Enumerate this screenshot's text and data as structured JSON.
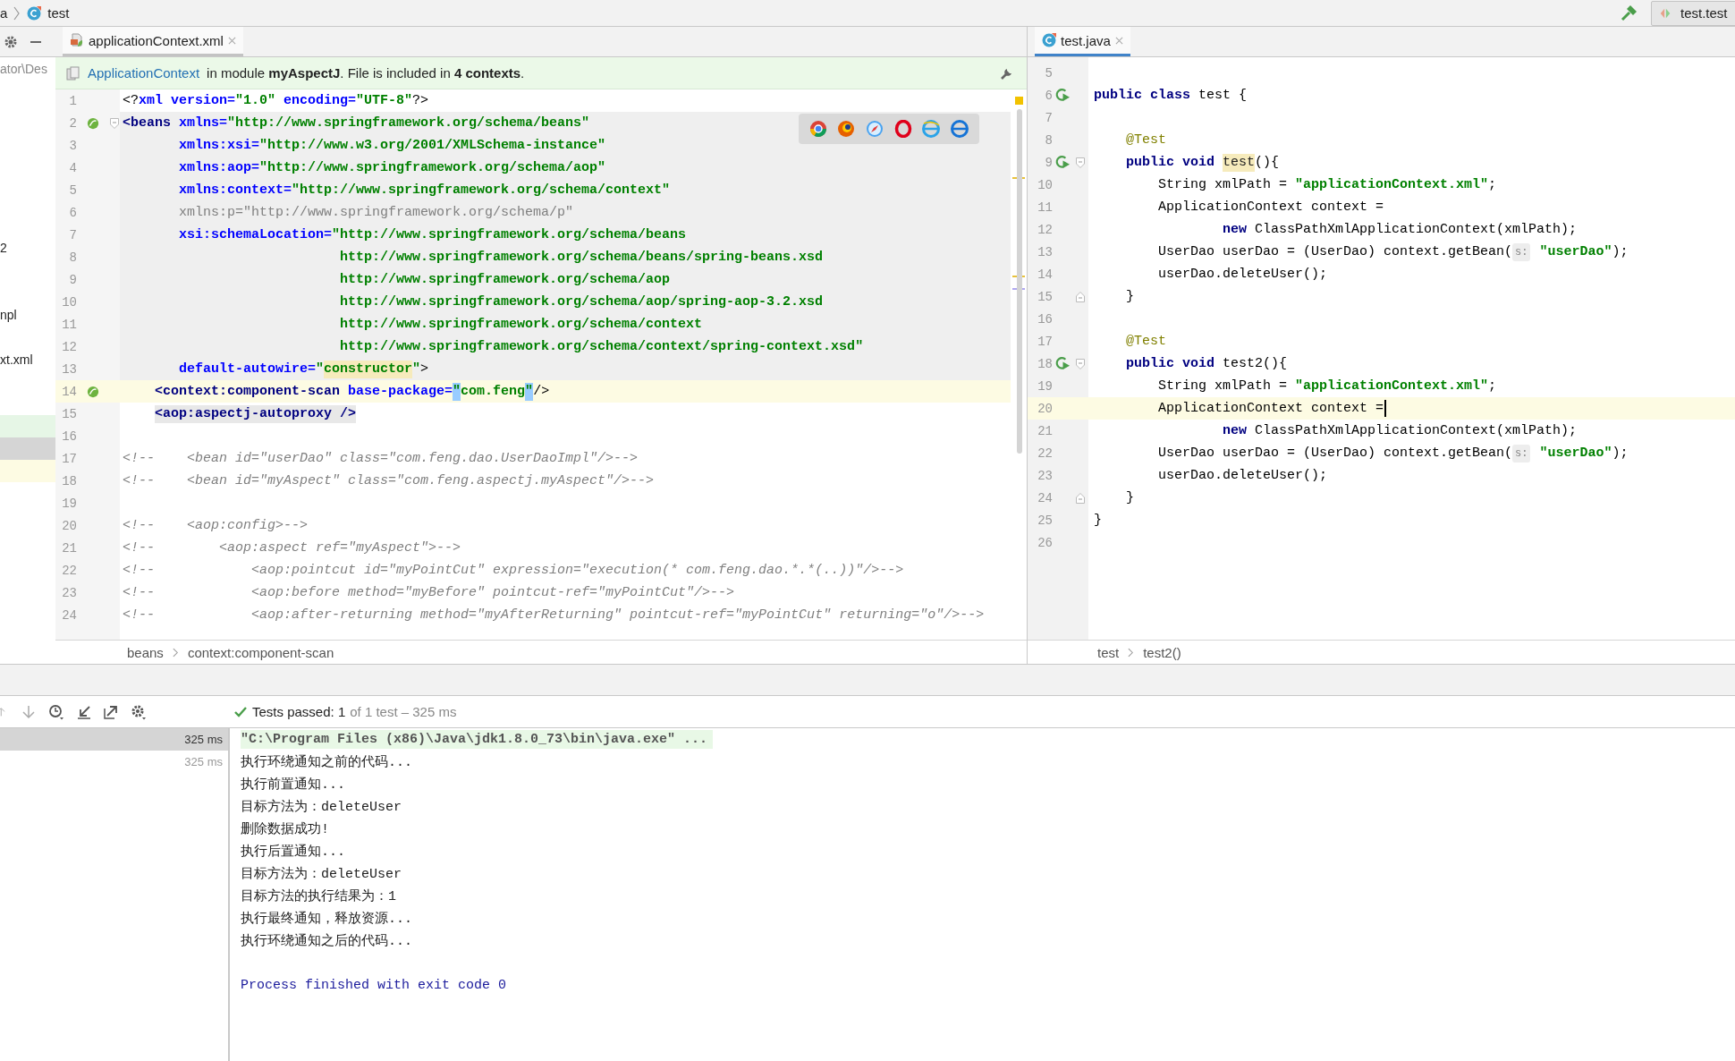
{
  "nav": {
    "breadcrumbs": [
      {
        "label": "a",
        "kind": "package"
      },
      {
        "label": "test",
        "kind": "class"
      }
    ],
    "run_config": "test.test"
  },
  "project_panel": {
    "rows": [
      {
        "kind": "path",
        "label": "ator\\Des"
      },
      {
        "kind": "blank"
      },
      {
        "kind": "blank"
      },
      {
        "kind": "blank"
      },
      {
        "kind": "blank"
      },
      {
        "kind": "blank"
      },
      {
        "kind": "blank"
      },
      {
        "kind": "blank"
      },
      {
        "kind": "item",
        "label": "2"
      },
      {
        "kind": "blank"
      },
      {
        "kind": "blank"
      },
      {
        "kind": "item",
        "label": "npl"
      },
      {
        "kind": "blank"
      },
      {
        "kind": "item",
        "label": "xt.xml"
      },
      {
        "kind": "blank"
      },
      {
        "kind": "blank"
      },
      {
        "kind": "added"
      },
      {
        "kind": "selected"
      },
      {
        "kind": "current"
      }
    ]
  },
  "editors": [
    {
      "focused": false,
      "tab": {
        "title": "applicationContext.xml",
        "kind": "xml",
        "selected": true
      },
      "banner": {
        "link": "ApplicationContext",
        "text": "in module **myAspectJ**. File is included in **4 contexts**."
      },
      "lines": [
        {
          "number": "1",
          "tokens": [
            {
              "kind": "plain",
              "text": "<?"
            },
            {
              "kind": "attr",
              "text": "xml version="
            },
            {
              "kind": "str",
              "text": "\"1.0\""
            },
            {
              "kind": "attr",
              "text": " encoding="
            },
            {
              "kind": "str",
              "text": "\"UTF-8\""
            },
            {
              "kind": "plain",
              "text": "?>"
            }
          ]
        },
        {
          "number": "2",
          "scope": true,
          "gutter_action": true,
          "fold_start": true,
          "tokens": [
            {
              "kind": "tag",
              "text": "<beans"
            },
            {
              "kind": "attr",
              "text": " xmlns="
            },
            {
              "kind": "str",
              "text": "\"http://www.springframework.org/schema/beans\""
            }
          ]
        },
        {
          "number": "3",
          "scope": true,
          "tokens": [
            {
              "kind": "attr",
              "text": "       xmlns:xsi="
            },
            {
              "kind": "str",
              "text": "\"http://www.w3.org/2001/XMLSchema-instance\""
            }
          ]
        },
        {
          "number": "4",
          "scope": true,
          "tokens": [
            {
              "kind": "attr",
              "text": "       xmlns:aop="
            },
            {
              "kind": "str",
              "text": "\"http://www.springframework.org/schema/aop\""
            }
          ]
        },
        {
          "number": "5",
          "scope": true,
          "tokens": [
            {
              "kind": "attr",
              "text": "       xmlns:context="
            },
            {
              "kind": "str",
              "text": "\"http://www.springframework.org/schema/context\""
            }
          ]
        },
        {
          "number": "6",
          "scope": true,
          "tokens": [
            {
              "kind": "unused",
              "text": "       xmlns:p=\"http://www.springframework.org/schema/p\""
            }
          ]
        },
        {
          "number": "7",
          "scope": true,
          "tokens": [
            {
              "kind": "attr",
              "text": "       xsi:schemaLocation="
            },
            {
              "kind": "str",
              "text": "\"http://www.springframework.org/schema/beans"
            }
          ]
        },
        {
          "number": "8",
          "scope": true,
          "tokens": [
            {
              "kind": "str",
              "text": "                           http://www.springframework.org/schema/beans/spring-beans.xsd"
            }
          ]
        },
        {
          "number": "9",
          "scope": true,
          "tokens": [
            {
              "kind": "str",
              "text": "                           http://www.springframework.org/schema/aop"
            }
          ]
        },
        {
          "number": "10",
          "scope": true,
          "tokens": [
            {
              "kind": "str",
              "text": "                           http://www.springframework.org/schema/aop/spring-aop-3.2.xsd"
            }
          ]
        },
        {
          "number": "11",
          "scope": true,
          "tokens": [
            {
              "kind": "str",
              "text": "                           http://www.springframework.org/schema/context"
            }
          ]
        },
        {
          "number": "12",
          "scope": true,
          "tokens": [
            {
              "kind": "str",
              "text": "                           http://www.springframework.org/schema/context/spring-context.xsd\""
            }
          ]
        },
        {
          "number": "13",
          "scope": true,
          "tokens": [
            {
              "kind": "attr",
              "text": "       default-autowire="
            },
            {
              "kind": "str",
              "text": "\""
            },
            {
              "kind": "match",
              "text": "constructor"
            },
            {
              "kind": "str",
              "text": "\""
            },
            {
              "kind": "plain",
              "text": ">"
            }
          ]
        },
        {
          "number": "14",
          "current": true,
          "gutter_action": true,
          "tokens": [
            {
              "kind": "tag",
              "text": "    <context:component-scan"
            },
            {
              "kind": "attr",
              "text": " base-package="
            },
            {
              "kind": "brace",
              "text": "\""
            },
            {
              "kind": "str",
              "text": "com.feng"
            },
            {
              "kind": "brace",
              "text": "\""
            },
            {
              "kind": "plain",
              "text": "/>"
            }
          ]
        },
        {
          "number": "15",
          "tokens": [
            {
              "kind": "tagmatch",
              "text": "    <aop:aspectj-autoproxy />"
            }
          ]
        },
        {
          "number": "16"
        },
        {
          "number": "17",
          "tokens": [
            {
              "kind": "comment",
              "text": "<!--    <bean id=\"userDao\" class=\"com.feng.dao.UserDaoImpl\"/>-->"
            }
          ]
        },
        {
          "number": "18",
          "tokens": [
            {
              "kind": "comment",
              "text": "<!--    <bean id=\"myAspect\" class=\"com.feng.aspectj.myAspect\"/>-->"
            }
          ]
        },
        {
          "number": "19"
        },
        {
          "number": "20",
          "tokens": [
            {
              "kind": "comment",
              "text": "<!--    <aop:config>-->"
            }
          ]
        },
        {
          "number": "21",
          "tokens": [
            {
              "kind": "comment",
              "text": "<!--        <aop:aspect ref=\"myAspect\">-->"
            }
          ]
        },
        {
          "number": "22",
          "tokens": [
            {
              "kind": "comment",
              "text": "<!--            <aop:pointcut id=\"myPointCut\" expression=\"execution(* com.feng.dao.*.*(..))\"/>-->"
            }
          ]
        },
        {
          "number": "23",
          "tokens": [
            {
              "kind": "comment",
              "text": "<!--            <aop:before method=\"myBefore\" pointcut-ref=\"myPointCut\"/>-->"
            }
          ]
        },
        {
          "number": "24",
          "tokens": [
            {
              "kind": "comment",
              "text": "<!--            <aop:after-returning method=\"myAfterReturning\" pointcut-ref=\"myPointCut\" returning=\"o\"/>-->"
            }
          ]
        }
      ],
      "breadcrumbs": [
        "beans",
        "context:component-scan"
      ]
    },
    {
      "focused": true,
      "tab": {
        "title": "test.java",
        "kind": "class",
        "selected": true
      },
      "lines": [
        {
          "number": "5"
        },
        {
          "number": "6",
          "gutter_action": true,
          "tokens": [
            {
              "kind": "kw",
              "text": "public class"
            },
            {
              "kind": "plain",
              "text": " test {"
            }
          ]
        },
        {
          "number": "7"
        },
        {
          "number": "8",
          "tokens": [
            {
              "kind": "ann",
              "text": "    @Test"
            }
          ]
        },
        {
          "number": "9",
          "gutter_action": true,
          "fold_start": true,
          "tokens": [
            {
              "kind": "kw",
              "text": "    public void "
            },
            {
              "kind": "usage",
              "text": "test"
            },
            {
              "kind": "plain",
              "text": "(){"
            }
          ]
        },
        {
          "number": "10",
          "tokens": [
            {
              "kind": "plain",
              "text": "        String xmlPath = "
            },
            {
              "kind": "str",
              "text": "\"applicationContext.xml\""
            },
            {
              "kind": "plain",
              "text": ";"
            }
          ]
        },
        {
          "number": "11",
          "tokens": [
            {
              "kind": "plain",
              "text": "        ApplicationContext context ="
            }
          ]
        },
        {
          "number": "12",
          "tokens": [
            {
              "kind": "kw",
              "text": "                new"
            },
            {
              "kind": "plain",
              "text": " ClassPathXmlApplicationContext(xmlPath);"
            }
          ]
        },
        {
          "number": "13",
          "tokens": [
            {
              "kind": "plain",
              "text": "        UserDao userDao = (UserDao) context.getBean("
            },
            {
              "kind": "hint",
              "text": "s:"
            },
            {
              "kind": "str",
              "text": " \"userDao\""
            },
            {
              "kind": "plain",
              "text": ");"
            }
          ]
        },
        {
          "number": "14",
          "tokens": [
            {
              "kind": "plain",
              "text": "        userDao.deleteUser();"
            }
          ]
        },
        {
          "number": "15",
          "fold_end": true,
          "tokens": [
            {
              "kind": "plain",
              "text": "    }"
            }
          ]
        },
        {
          "number": "16"
        },
        {
          "number": "17",
          "tokens": [
            {
              "kind": "ann",
              "text": "    @Test"
            }
          ]
        },
        {
          "number": "18",
          "gutter_action": true,
          "fold_start": true,
          "tokens": [
            {
              "kind": "kw",
              "text": "    public void"
            },
            {
              "kind": "plain",
              "text": " test2(){"
            }
          ]
        },
        {
          "number": "19",
          "tokens": [
            {
              "kind": "plain",
              "text": "        String xmlPath = "
            },
            {
              "kind": "str",
              "text": "\"applicationContext.xml\""
            },
            {
              "kind": "plain",
              "text": ";"
            }
          ]
        },
        {
          "number": "20",
          "current": true,
          "caret": true,
          "tokens": [
            {
              "kind": "plain",
              "text": "        ApplicationContext context ="
            }
          ]
        },
        {
          "number": "21",
          "tokens": [
            {
              "kind": "kw",
              "text": "                new"
            },
            {
              "kind": "plain",
              "text": " ClassPathXmlApplicationContext(xmlPath);"
            }
          ]
        },
        {
          "number": "22",
          "tokens": [
            {
              "kind": "plain",
              "text": "        UserDao userDao = (UserDao) context.getBean("
            },
            {
              "kind": "hint",
              "text": "s:"
            },
            {
              "kind": "str",
              "text": " \"userDao\""
            },
            {
              "kind": "plain",
              "text": ");"
            }
          ]
        },
        {
          "number": "23",
          "tokens": [
            {
              "kind": "plain",
              "text": "        userDao.deleteUser();"
            }
          ]
        },
        {
          "number": "24",
          "fold_end": true,
          "tokens": [
            {
              "kind": "plain",
              "text": "    }"
            }
          ]
        },
        {
          "number": "25",
          "tokens": [
            {
              "kind": "plain",
              "text": "}"
            }
          ]
        },
        {
          "number": "26"
        }
      ],
      "breadcrumbs": [
        "test",
        "test2()"
      ]
    }
  ],
  "run_panel": {
    "summary": "Tests passed: 1",
    "detail": "of 1 test – 325 ms",
    "tests": [
      {
        "duration": "325 ms",
        "selected": true
      },
      {
        "duration": "325 ms",
        "selected": false
      }
    ],
    "console": [
      {
        "kind": "command",
        "text": "\"C:\\Program Files (x86)\\Java\\jdk1.8.0_73\\bin\\java.exe\" ..."
      },
      {
        "kind": "output",
        "text": "执行环绕通知之前的代码..."
      },
      {
        "kind": "output",
        "text": "执行前置通知..."
      },
      {
        "kind": "output",
        "text": "目标方法为：deleteUser"
      },
      {
        "kind": "output",
        "text": "删除数据成功!"
      },
      {
        "kind": "output",
        "text": "执行后置通知..."
      },
      {
        "kind": "output",
        "text": "目标方法为：deleteUser"
      },
      {
        "kind": "output",
        "text": "目标方法的执行结果为：1"
      },
      {
        "kind": "output",
        "text": "执行最终通知，释放资源..."
      },
      {
        "kind": "output",
        "text": "执行环绕通知之后的代码..."
      },
      {
        "kind": "exit",
        "text": "Process finished with exit code 0"
      }
    ]
  }
}
